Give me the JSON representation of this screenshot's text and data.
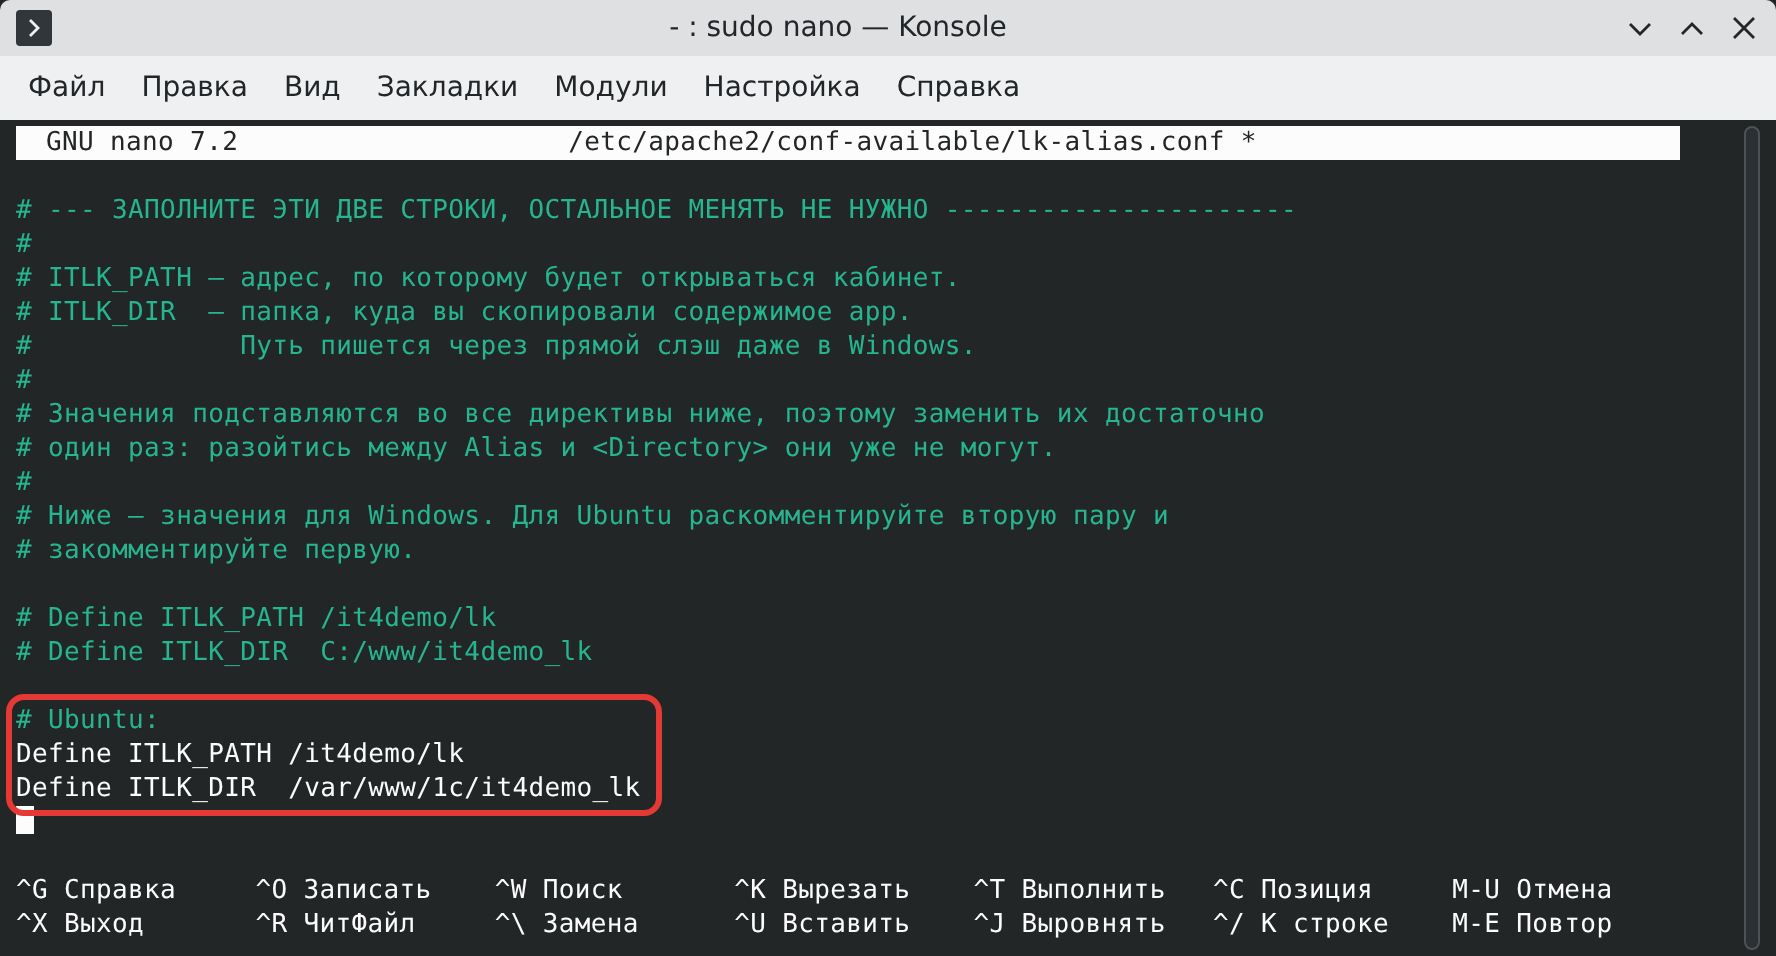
{
  "window": {
    "title": "- : sudo nano — Konsole"
  },
  "menu": [
    "Файл",
    "Правка",
    "Вид",
    "Закладки",
    "Модули",
    "Настройка",
    "Справка"
  ],
  "nano": {
    "version": "GNU nano 7.2",
    "file": "/etc/apache2/conf-available/lk-alias.conf *",
    "lines": [
      {
        "kind": "blank"
      },
      {
        "kind": "comment",
        "text": "# --- ЗАПОЛНИТЕ ЭТИ ДВЕ СТРОКИ, ОСТАЛЬНОЕ МЕНЯТЬ НЕ НУЖНО ----------------------"
      },
      {
        "kind": "comment",
        "text": "#"
      },
      {
        "kind": "comment",
        "text": "# ITLK_PATH — адрес, по которому будет открываться кабинет."
      },
      {
        "kind": "comment",
        "text": "# ITLK_DIR  — папка, куда вы скопировали содержимое app."
      },
      {
        "kind": "comment",
        "text": "#             Путь пишется через прямой слэш даже в Windows."
      },
      {
        "kind": "comment",
        "text": "#"
      },
      {
        "kind": "comment",
        "text": "# Значения подставляются во все директивы ниже, поэтому заменить их достаточно"
      },
      {
        "kind": "comment",
        "text": "# один раз: разойтись между Alias и <Directory> они уже не могут."
      },
      {
        "kind": "comment",
        "text": "#"
      },
      {
        "kind": "comment",
        "text": "# Ниже — значения для Windows. Для Ubuntu раскомментируйте вторую пару и"
      },
      {
        "kind": "comment",
        "text": "# закомментируйте первую."
      },
      {
        "kind": "blank"
      },
      {
        "kind": "comment",
        "text": "# Define ITLK_PATH /it4demo/lk"
      },
      {
        "kind": "comment",
        "text": "# Define ITLK_DIR  C:/www/it4demo_lk"
      },
      {
        "kind": "blank"
      }
    ],
    "framed_lines": [
      {
        "kind": "comment",
        "text": "# Ubuntu:"
      },
      {
        "kind": "code",
        "text": "Define ITLK_PATH /it4demo/lk"
      },
      {
        "kind": "code",
        "text": "Define ITLK_DIR  /var/www/1c/it4demo_lk"
      }
    ],
    "lines_after": [
      {
        "kind": "cursor"
      },
      {
        "kind": "blank"
      }
    ],
    "shortcut_rows": [
      [
        {
          "key": "^G",
          "label": "Справка"
        },
        {
          "key": "^O",
          "label": "Записать"
        },
        {
          "key": "^W",
          "label": "Поиск"
        },
        {
          "key": "^K",
          "label": "Вырезать"
        },
        {
          "key": "^T",
          "label": "Выполнить"
        },
        {
          "key": "^C",
          "label": "Позиция"
        },
        {
          "key": "M-U",
          "label": "Отмена"
        }
      ],
      [
        {
          "key": "^X",
          "label": "Выход"
        },
        {
          "key": "^R",
          "label": "ЧитФайл"
        },
        {
          "key": "^\\",
          "label": "Замена"
        },
        {
          "key": "^U",
          "label": "Вставить"
        },
        {
          "key": "^J",
          "label": "Выровнять"
        },
        {
          "key": "^/",
          "label": "К строке"
        },
        {
          "key": "M-E",
          "label": "Повтор"
        }
      ]
    ]
  }
}
